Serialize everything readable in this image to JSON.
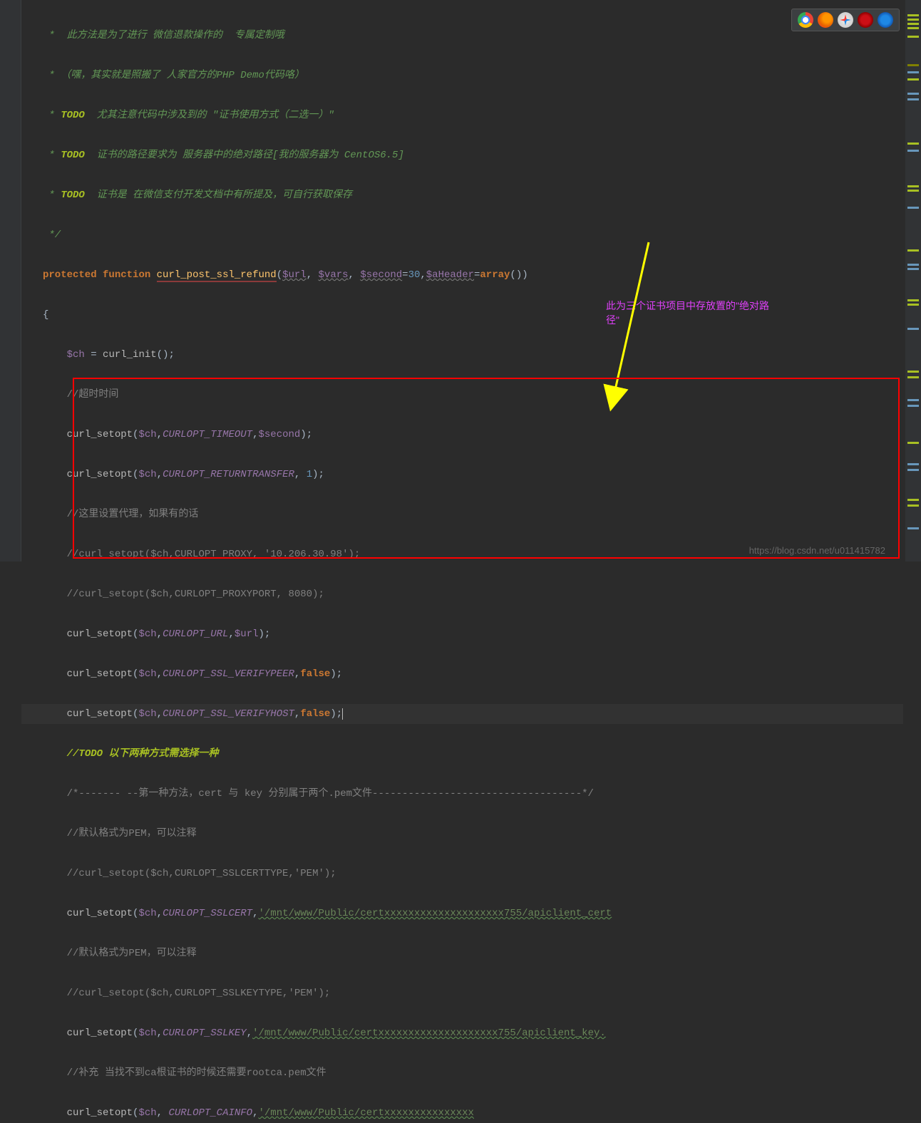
{
  "comments": {
    "c1": " *  此方法是为了进行 微信退款操作的  专属定制哦",
    "c2": " * （嘿，其实就是照搬了 人家官方的PHP Demo代码咯）",
    "c3_pre": " * ",
    "c3_todo": "TODO",
    "c3_post": "  尤其注意代码中涉及到的 \"证书使用方式（二选一）\"",
    "c4_pre": " * ",
    "c4_todo": "TODO",
    "c4_post": "  证书的路径要求为 服务器中的绝对路径[我的服务器为 CentOS6.5]",
    "c5_pre": " * ",
    "c5_todo": "TODO",
    "c5_post": "  证书是 在微信支付开发文档中有所提及，可自行获取保存",
    "c6": " */",
    "timeout": "//超时时间",
    "proxy_comment": "//这里设置代理，如果有的话",
    "proxy1": "//curl_setopt($ch,CURLOPT_PROXY, '10.206.30.98');",
    "proxy2": "//curl_setopt($ch,CURLOPT_PROXYPORT, 8080);",
    "todo_line_pre": "//",
    "todo_line_todo": "TODO",
    "todo_line_post": " 以下两种方式需选择一种",
    "method1": "/*------- --第一种方法，cert 与 key 分别属于两个.pem文件-----------------------------------*/",
    "pem1": "//默认格式为PEM，可以注释",
    "sslcerttype": "//curl_setopt($ch,CURLOPT_SSLCERTTYPE,'PEM');",
    "pem2": "//默认格式为PEM，可以注释",
    "sslkeytype": "//curl_setopt($ch,CURLOPT_SSLKEYTYPE,'PEM');",
    "rootca": "//补充 当找不到ca根证书的时候还需要rootca.pem文件"
  },
  "code": {
    "protected": "protected",
    "function": "function",
    "func_name": "curl_post_ssl_refund",
    "url_var": "$url",
    "vars_var": "$vars",
    "second_var": "$second",
    "second_default": "30",
    "aheader_var": "$aHeader",
    "array": "array",
    "ch_var": "$ch",
    "curl_init": "curl_init",
    "curl_setopt": "curl_setopt",
    "timeout_const": "CURLOPT_TIMEOUT",
    "returntransfer_const": "CURLOPT_RETURNTRANSFER",
    "url_const": "CURLOPT_URL",
    "verifypeer_const": "CURLOPT_SSL_VERIFYPEER",
    "verifyhost_const": "CURLOPT_SSL_VERIFYHOST",
    "sslcert_const": "CURLOPT_SSLCERT",
    "sslkey_const": "CURLOPT_SSLKEY",
    "cainfo_const": "CURLOPT_CAINFO",
    "false": "false",
    "one": "1",
    "cert_path": "'/mnt/www/Public/certxxxxxxxxxxxxxxxxxxxx755/apiclient_cert",
    "key_path": "'/mnt/www/Public/certxxxxxxxxxxxxxxxxxxxx755/apiclient_key.",
    "ca_path": "'/mnt/www/Public/certxxxxxxxxxxxxxxx"
  },
  "annotation": {
    "text1": "此为三个证书项目中存放置的\"绝对路",
    "text2": "径\""
  },
  "watermark": "https://blog.csdn.net/u011415782",
  "browsers": [
    "chrome",
    "firefox",
    "safari",
    "opera",
    "ie"
  ]
}
